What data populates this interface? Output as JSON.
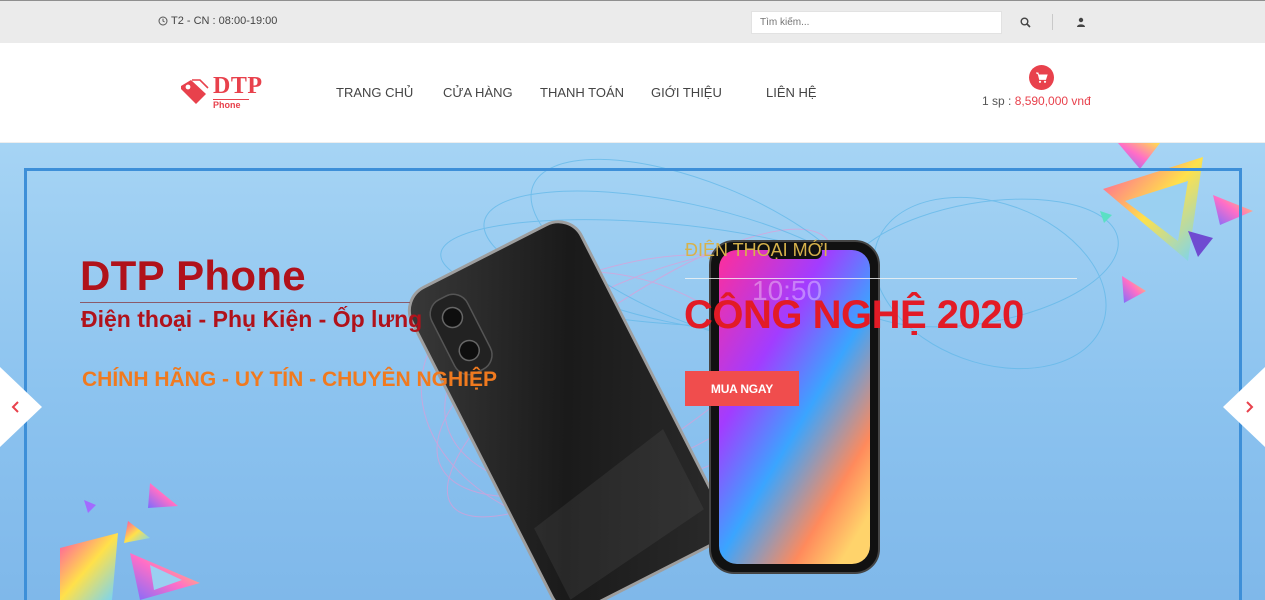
{
  "topbar": {
    "hours_text": "T2 - CN : 08:00-19:00",
    "search_placeholder": "Tìm kiếm..."
  },
  "brand": {
    "logo_main": "DTP",
    "logo_sub": "Phone"
  },
  "nav": {
    "items": [
      {
        "label": "TRANG CHỦ"
      },
      {
        "label": "CỬA HÀNG"
      },
      {
        "label": "THANH TOÁN"
      },
      {
        "label": "GIỚI THIỆU"
      },
      {
        "label": "LIÊN HỆ"
      }
    ]
  },
  "cart": {
    "count_text": "1 sp : ",
    "total_text": "8,590,000 vnđ"
  },
  "banner": {
    "title_main": "DTP Phone",
    "title_sub": "Điện thoại - Phụ Kiện - Ốp lưng",
    "title_tag": "CHÍNH HÃNG - UY TÍN - CHUYÊN NGHIỆP",
    "promo_kicker": "ĐIỆN THOẠI MỚI",
    "promo_headline": "CÔNG NGHỆ 2020",
    "buy_label": "MUA NGAY",
    "phone_clock": "10:50"
  },
  "icons": {
    "clock": "clock-icon",
    "search": "search-icon",
    "user": "user-icon",
    "cart": "cart-icon",
    "prev": "chevron-left-icon",
    "next": "chevron-right-icon"
  },
  "colors": {
    "brand_red": "#e8414c",
    "title_red": "#b0121b",
    "tag_orange": "#f07a1f",
    "headline_red": "#e21b26",
    "kicker_gold": "#d7b24b",
    "button_red": "#f04d4d",
    "banner_blue": "#a6d4f4"
  }
}
